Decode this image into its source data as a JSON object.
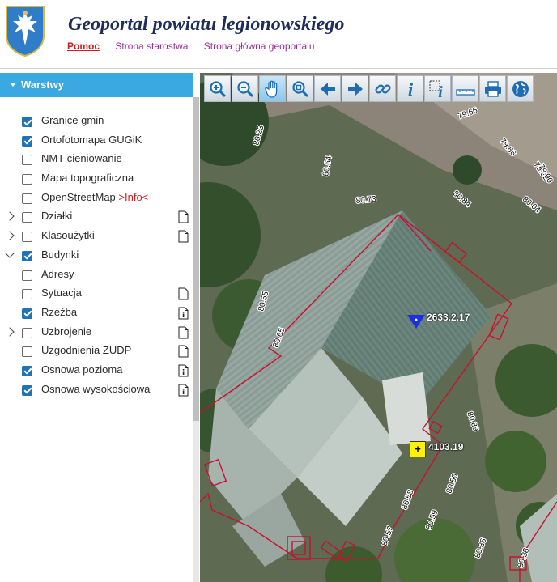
{
  "header": {
    "title": "Geoportal powiatu legionowskiego",
    "nav": [
      {
        "label": "Pomoc",
        "active": true
      },
      {
        "label": "Strona starostwa",
        "active": false
      },
      {
        "label": "Strona główna geoportalu",
        "active": false
      }
    ],
    "crest_icon": "coat-of-arms-eagle-icon"
  },
  "sidebar": {
    "panel_title": "Warstwy",
    "layers": [
      {
        "label": "Granice gmin",
        "checked": true,
        "expandable": false,
        "expanded": false,
        "legend": "none"
      },
      {
        "label": "Ortofotomapa GUGiK",
        "checked": true,
        "expandable": false,
        "expanded": false,
        "legend": "none"
      },
      {
        "label": "NMT-cieniowanie",
        "checked": false,
        "expandable": false,
        "expanded": false,
        "legend": "none"
      },
      {
        "label": "Mapa topograficzna",
        "checked": false,
        "expandable": false,
        "expanded": false,
        "legend": "none"
      },
      {
        "label": "OpenStreetMap",
        "info": ">Info<",
        "checked": false,
        "expandable": false,
        "expanded": false,
        "legend": "none"
      },
      {
        "label": "Działki",
        "checked": false,
        "expandable": true,
        "expanded": false,
        "legend": "doc"
      },
      {
        "label": "Klasoużytki",
        "checked": false,
        "expandable": true,
        "expanded": false,
        "legend": "doc"
      },
      {
        "label": "Budynki",
        "checked": true,
        "expandable": true,
        "expanded": true,
        "legend": "none"
      },
      {
        "label": "Adresy",
        "checked": false,
        "expandable": false,
        "expanded": false,
        "legend": "none"
      },
      {
        "label": "Sytuacja",
        "checked": false,
        "expandable": false,
        "expanded": false,
        "legend": "doc"
      },
      {
        "label": "Rzeźba",
        "checked": true,
        "expandable": false,
        "expanded": false,
        "legend": "doc-info"
      },
      {
        "label": "Uzbrojenie",
        "checked": false,
        "expandable": true,
        "expanded": false,
        "legend": "doc"
      },
      {
        "label": "Uzgodnienia ZUDP",
        "checked": false,
        "expandable": false,
        "expanded": false,
        "legend": "doc"
      },
      {
        "label": "Osnowa pozioma",
        "checked": true,
        "expandable": false,
        "expanded": false,
        "legend": "doc-info"
      },
      {
        "label": "Osnowa wysokościowa",
        "checked": true,
        "expandable": false,
        "expanded": false,
        "legend": "doc-info"
      }
    ]
  },
  "toolbar": {
    "tools": [
      {
        "name": "zoom-in-icon",
        "active": false
      },
      {
        "name": "zoom-out-icon",
        "active": false
      },
      {
        "name": "pan-hand-icon",
        "active": true
      },
      {
        "name": "zoom-box-icon",
        "active": false
      },
      {
        "name": "previous-view-arrow-icon",
        "active": false
      },
      {
        "name": "next-view-arrow-icon",
        "active": false
      },
      {
        "name": "link-chain-icon",
        "active": false
      },
      {
        "name": "info-icon",
        "active": false
      },
      {
        "name": "info-selection-icon",
        "active": false
      },
      {
        "name": "measure-ruler-icon",
        "active": false
      },
      {
        "name": "print-icon",
        "active": false
      },
      {
        "name": "globe-icon",
        "active": false
      }
    ]
  },
  "map": {
    "control_points": [
      {
        "label": "2633.2.17",
        "symbol": "blue-triangle-icon"
      },
      {
        "label": "4103.19",
        "symbol": "yellow-plus-icon"
      }
    ],
    "elevation_labels": [
      "79.66",
      "79.86",
      "79.92",
      "79.90",
      "80.23",
      "80.64",
      "80.73",
      "80.84",
      "80.04",
      "80.55",
      "80.65",
      "80.89",
      "80.50",
      "80.59",
      "80.58",
      "80.57",
      "80.36",
      "80.38"
    ],
    "colors": {
      "building_outline": "#c8102e",
      "accent": "#3aa8e1"
    }
  }
}
